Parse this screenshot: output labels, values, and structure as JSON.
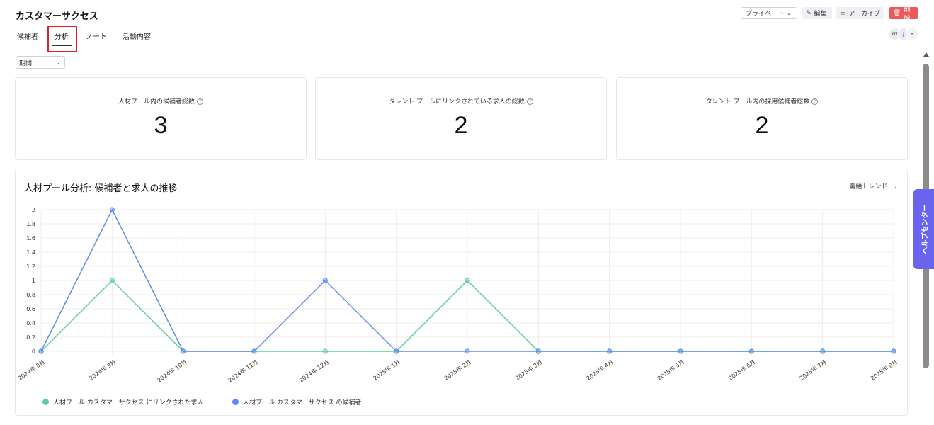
{
  "page": {
    "title": "カスタマーサクセス"
  },
  "tabs": [
    {
      "label": "候補者"
    },
    {
      "label": "分析"
    },
    {
      "label": "ノート"
    },
    {
      "label": "活動内容"
    }
  ],
  "header_actions": {
    "visibility": "プライベート",
    "edit": "編集",
    "archive": "アーカイブ",
    "delete": "削除"
  },
  "avatars": [
    {
      "initials": "NT",
      "color": "#e6efe5"
    },
    {
      "initials": "J",
      "color": "#ede7f8"
    },
    {
      "initials": "+",
      "color": "#f2f2f2"
    }
  ],
  "filter": {
    "period": "期間"
  },
  "stats": [
    {
      "label": "人材プール内の候補者総数",
      "value": "3"
    },
    {
      "label": "タレント プールにリンクされている求人の総数",
      "value": "2"
    },
    {
      "label": "タレント プール内の採用候補者総数",
      "value": "2"
    }
  ],
  "chart_section": {
    "title": "人材プール分析: 候補者と求人の推移",
    "trend_option": "需給トレンド"
  },
  "chart_data": {
    "type": "line",
    "title": "人材プール分析: 候補者と求人の推移",
    "categories": [
      "2024年 8月",
      "2024年 9月",
      "2024年 10月",
      "2024年 11月",
      "2024年 12月",
      "2025年 1月",
      "2025年 2月",
      "2025年 3月",
      "2025年 4月",
      "2025年 5月",
      "2025年 6月",
      "2025年 7月",
      "2025年 8月"
    ],
    "ylim": [
      0,
      2
    ],
    "yticks": [
      "0",
      "0.2",
      "0.4",
      "0.6",
      "0.8",
      "1",
      "1.2",
      "1.4",
      "1.6",
      "1.8",
      "2"
    ],
    "grid": true,
    "legend_position": "bottom-left",
    "series": [
      {
        "name": "人材プール カスタマーサクセス にリンクされた求人",
        "color": "#5ccf9f",
        "values": [
          0,
          1,
          0,
          0,
          0,
          0,
          1,
          0,
          0,
          0,
          0,
          0,
          0
        ]
      },
      {
        "name": "人材プール カスタマーサクセス の候補者",
        "color": "#5b8def",
        "values": [
          0,
          2,
          0,
          0,
          1,
          0,
          0,
          0,
          0,
          0,
          0,
          0,
          0
        ]
      }
    ]
  },
  "help_center": {
    "label": "ヘルプセンター"
  }
}
